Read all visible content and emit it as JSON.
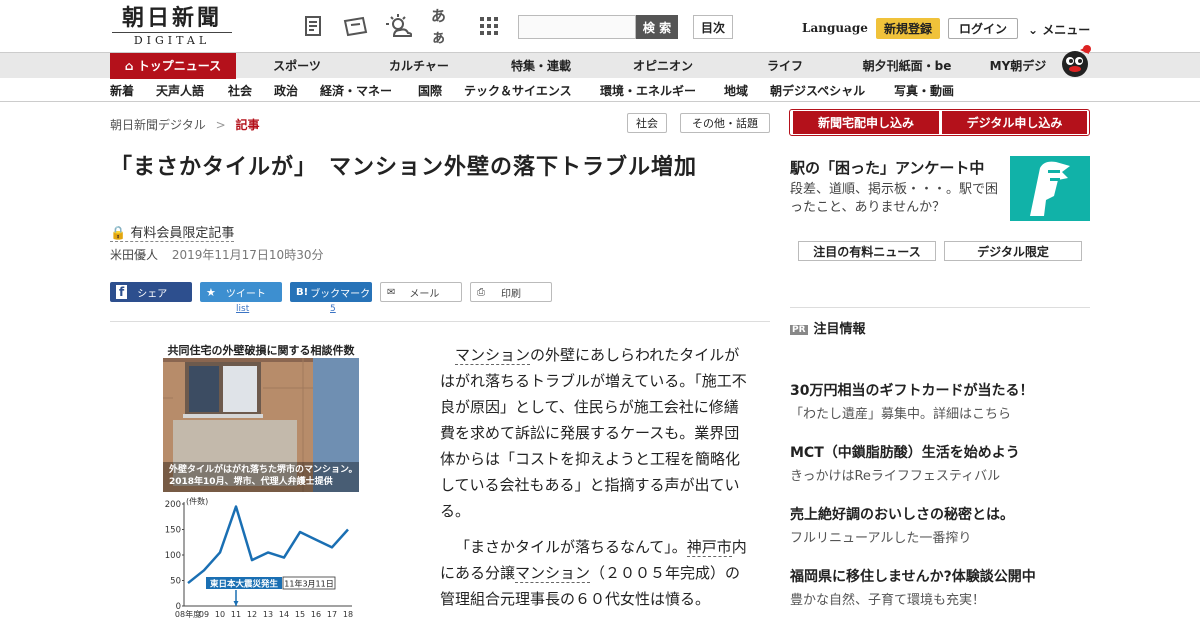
{
  "header": {
    "logo_jp": "朝日新聞",
    "logo_en": "DIGITAL",
    "search_button": "検 索",
    "index_button": "目次",
    "language": "Language",
    "register": "新規登録",
    "login": "ログイン",
    "menu": "メニュー",
    "icons": [
      "newspaper-icon",
      "ticket-icon",
      "weather-icon",
      "font-size-icon",
      "grid-icon"
    ],
    "font_size_glyph": "あぁ"
  },
  "nav_primary": [
    "トップニュース",
    "スポーツ",
    "カルチャー",
    "特集・連載",
    "オピニオン",
    "ライフ",
    "朝夕刊紙面・be",
    "MY朝デジ"
  ],
  "nav_secondary": [
    "新着",
    "天声人語",
    "社会",
    "政治",
    "経済・マネー",
    "国際",
    "テック＆サイエンス",
    "環境・エネルギー",
    "地域",
    "朝デジスペシャル",
    "写真・動画"
  ],
  "breadcrumb": {
    "root": "朝日新聞デジタル",
    "sep": ">",
    "current": "記事"
  },
  "tags": [
    "社会",
    "その他・話題"
  ],
  "article": {
    "title": "「まさかタイルが」　マンション外壁の落下トラブル増加",
    "paid_label": "有料会員限定記事",
    "author": "米田優人",
    "date": "2019年11月17日10時30分",
    "share": {
      "facebook": "シェア",
      "twitter": "ツイート",
      "twitter_count": "list",
      "hatena": "ブックマーク",
      "hatena_count": "5",
      "mail": "メール",
      "print": "印刷"
    },
    "figure": {
      "title": "共同住宅の外壁破損に関する相談件数",
      "caption_line1": "外壁タイルがはがれ落ちた堺市のマンション。",
      "caption_line2": "2018年10月、堺市、代理人弁護士提供",
      "y_unit": "(件数)",
      "annotation": "東日本大震災発生",
      "annotation_date": "11年3月11日"
    },
    "p1_link": "マンション",
    "p1_rest": "の外壁にあしらわれたタイルがはがれ落ちるトラブルが増えている。「施工不良が原因」として、住民らが施工会社に修繕費を求めて訴訟に発展するケースも。業界団体からは「コストを抑えようと工程を簡略化している会社もある」と指摘する声が出ている。",
    "p2_a": "「まさかタイルが落ちるなんて」。",
    "p2_link1": "神戸市",
    "p2_b": "内にある分譲",
    "p2_link2": "マンション",
    "p2_c": "（２００５年完成）の管理組合元理事長の６０代女性は憤る。"
  },
  "chart_data": {
    "type": "line",
    "title": "共同住宅の外壁破損に関する相談件数",
    "ylabel": "(件数)",
    "ylim": [
      0,
      200
    ],
    "yticks": [
      "0",
      "50",
      "100",
      "150",
      "200"
    ],
    "categories": [
      "08年度",
      "09",
      "10",
      "11",
      "12",
      "13",
      "14",
      "15",
      "16",
      "17",
      "18"
    ],
    "values": [
      45,
      70,
      105,
      195,
      90,
      105,
      95,
      145,
      130,
      115,
      150
    ],
    "color": "#1a6fb3",
    "grid": false
  },
  "sidebar": {
    "btn_home": "新聞宅配申し込み",
    "btn_digital": "デジタル申し込み",
    "promo_title": "駅の「困った」アンケート中",
    "promo_text": "段差、道順、掲示板・・・。駅で困ったこと、ありませんか？",
    "btn_news": "注目の有料ニュース",
    "btn_limited": "デジタル限定",
    "pr_badge": "PR",
    "pr_title": "注目情報",
    "ads": [
      {
        "title": "30万円相当のギフトカードが当たる！",
        "sub": "「わたし遺産」募集中。詳細はこちら"
      },
      {
        "title": "MCT（中鎖脂肪酸）生活を始めよう",
        "sub": "きっかけはReライフフェスティバル"
      },
      {
        "title": "売上絶好調のおいしさの秘密とは。",
        "sub": "フルリニューアルした一番搾り"
      },
      {
        "title": "福岡県に移住しませんか?体験談公開中",
        "sub": "豊かな自然、子育て環境も充実！"
      }
    ]
  },
  "colors": {
    "brand_red": "#b4111b",
    "register_yellow": "#f0c23a",
    "promo_teal": "#11b2a8",
    "chart_blue": "#1a6fb3"
  }
}
